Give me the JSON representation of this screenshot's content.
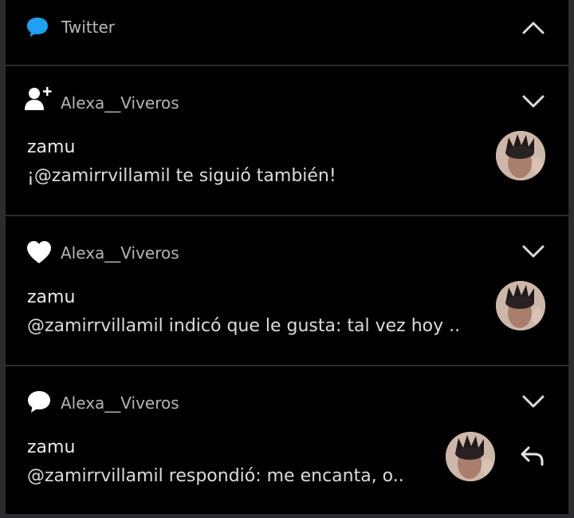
{
  "header": {
    "app_name": "Twitter",
    "icon": "speech-bubble-icon",
    "accent_color": "#1da1f2",
    "collapse_icon": "chevron-up-icon"
  },
  "notifications": [
    {
      "type_icon": "follow-person-plus-icon",
      "account": "Alexa__Viveros",
      "sender": "zamu",
      "text": "¡@zamirrvillamil te siguió también!",
      "expand_icon": "chevron-down-icon"
    },
    {
      "type_icon": "heart-icon",
      "account": "Alexa__Viveros",
      "sender": "zamu",
      "text": "@zamirrvillamil indicó que le gusta: tal vez hoy ..",
      "expand_icon": "chevron-down-icon"
    },
    {
      "type_icon": "reply-bubble-icon",
      "account": "Alexa__Viveros",
      "sender": "zamu",
      "text": "@zamirrvillamil respondió: me encanta, o..",
      "expand_icon": "chevron-down-icon",
      "action_icon": "reply-arrow-icon"
    }
  ]
}
